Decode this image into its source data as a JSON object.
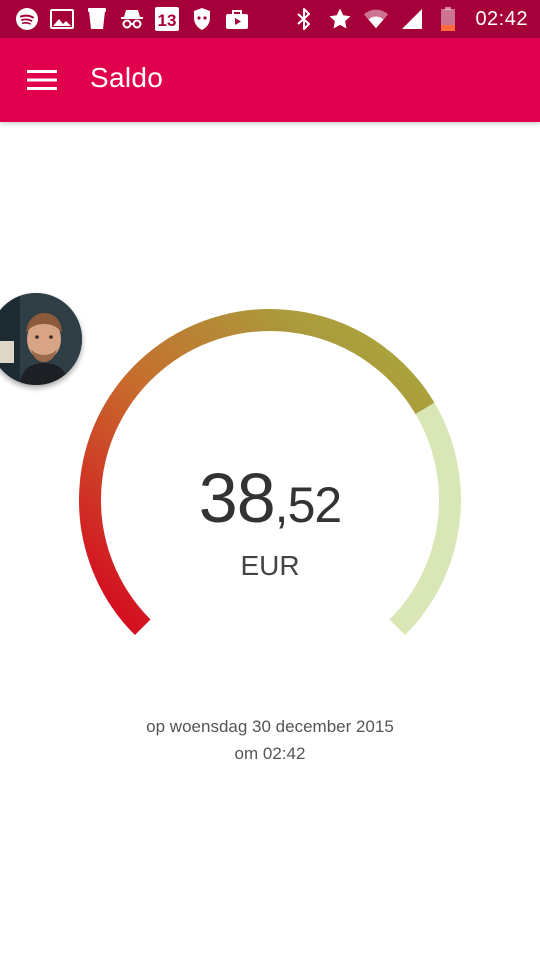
{
  "status_bar": {
    "time": "02:42",
    "color": "#a5003a",
    "left_icons": [
      "spotify-icon",
      "image-icon",
      "cup-icon",
      "incognito-icon",
      "calendar-13-icon",
      "shield-icon",
      "briefcase-icon"
    ],
    "right_icons": [
      "bluetooth-icon",
      "star-icon",
      "wifi-icon",
      "signal-icon",
      "battery-low-icon"
    ],
    "calendar_day": "13"
  },
  "app_bar": {
    "title": "Saldo",
    "color": "#e0004d"
  },
  "balance": {
    "integer": "38",
    "decimal": ",52",
    "currency": "EUR",
    "level": 0.72
  },
  "gauge": {
    "gradient": [
      "#d6001f",
      "#c86a2c",
      "#ab9a3c",
      "#a9ab3a"
    ],
    "remaining_color": "#d9e7b7"
  },
  "timestamp": {
    "date": "op woensdag 30 december 2015",
    "time": "om 02:42"
  }
}
